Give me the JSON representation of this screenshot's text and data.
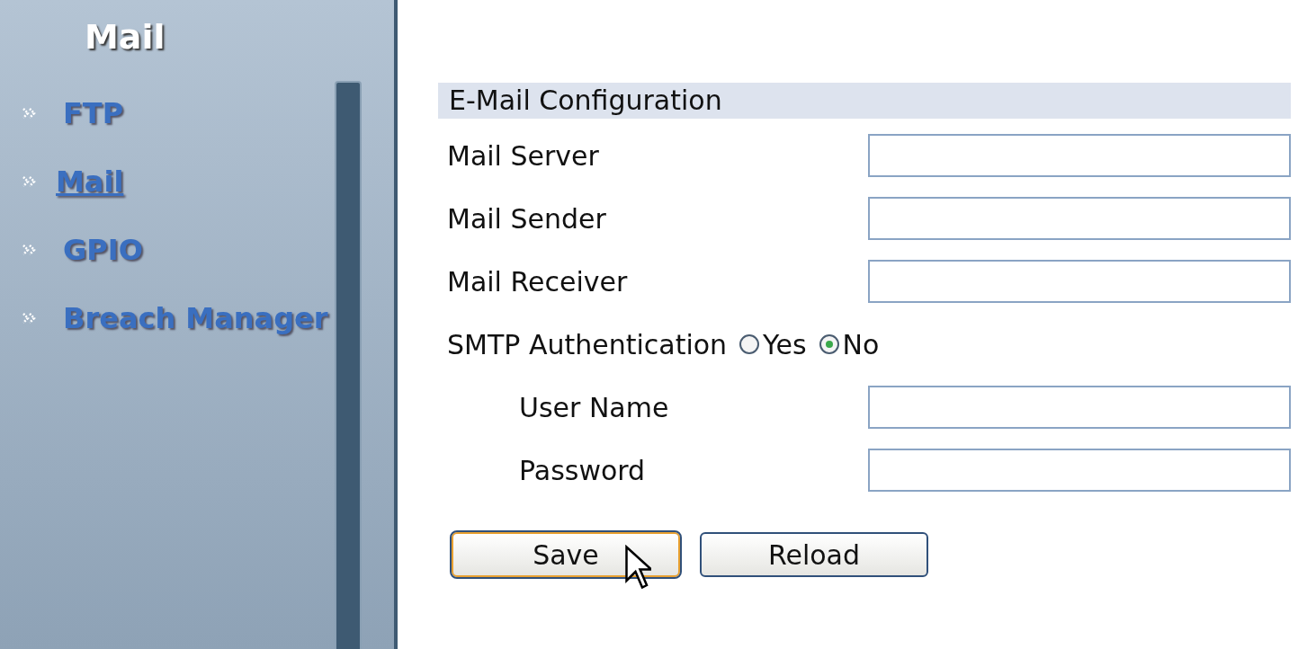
{
  "sidebar": {
    "title": "Mail",
    "items": [
      {
        "label": "FTP",
        "selected": false
      },
      {
        "label": "Mail",
        "selected": true
      },
      {
        "label": "GPIO",
        "selected": false
      },
      {
        "label": "Breach Manager",
        "selected": false
      }
    ]
  },
  "form": {
    "title": "E-Mail Configuration",
    "rows": [
      {
        "kind": "text",
        "label": "Mail Server",
        "indented": false
      },
      {
        "kind": "text",
        "label": "Mail Sender",
        "indented": false
      },
      {
        "kind": "text",
        "label": "Mail Receiver",
        "indented": false
      },
      {
        "kind": "radio",
        "label": "SMTP Authentication",
        "indented": false,
        "options": [
          {
            "label": "Yes",
            "selected": false
          },
          {
            "label": "No",
            "selected": true
          }
        ]
      },
      {
        "kind": "text",
        "label": "User Name",
        "indented": true
      },
      {
        "kind": "password",
        "label": "Password",
        "indented": true
      }
    ]
  },
  "buttons": [
    {
      "label": "Save",
      "focused": true
    },
    {
      "label": "Reload",
      "focused": false
    }
  ]
}
